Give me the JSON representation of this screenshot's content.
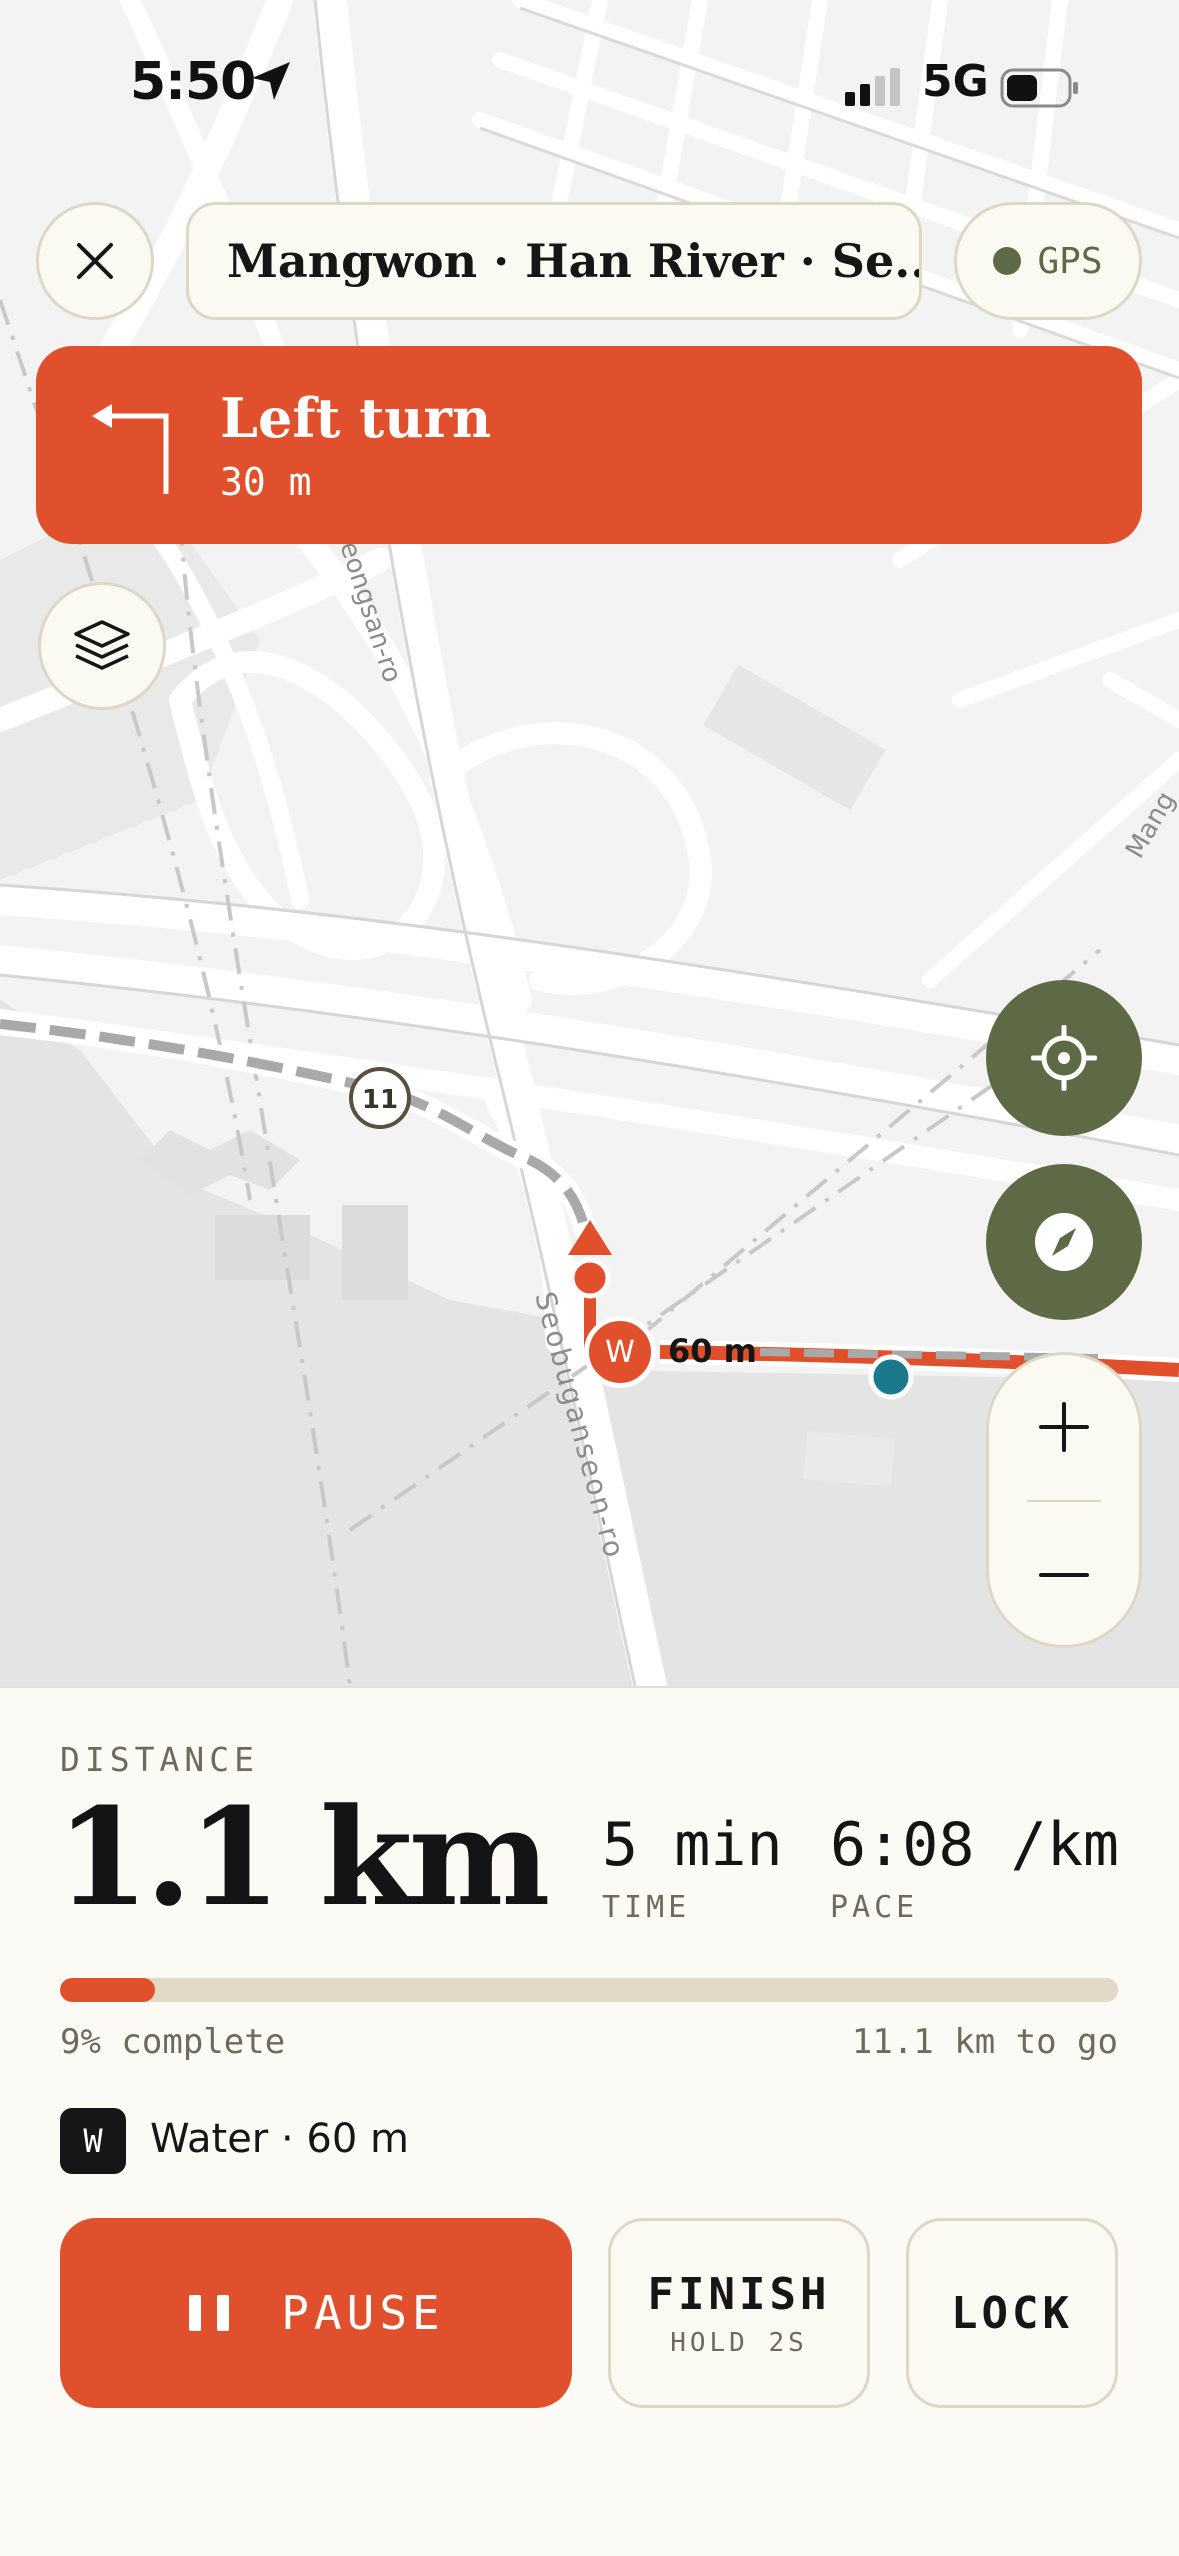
{
  "status_bar": {
    "time": "5:50",
    "network": "5G"
  },
  "top_bar": {
    "route_title": "Mangwon · Han River · Se...",
    "gps_label": "GPS"
  },
  "turn": {
    "title": "Left turn",
    "distance": "30 m"
  },
  "map": {
    "road_labels": [
      "eongsan-ro",
      "Seobuganseon-ro",
      "Mang"
    ],
    "route_shield": "11",
    "waypoint_badge": "W",
    "waypoint_distance": "60 m"
  },
  "stats": {
    "distance_label": "DISTANCE",
    "distance_value": "1.1 km",
    "time_value": "5 min",
    "time_label": "TIME",
    "pace_value": "6:08 /km",
    "pace_label": "PACE"
  },
  "progress": {
    "fraction": 0.09,
    "complete_text": "9% complete",
    "remaining_text": "11.1 km to go"
  },
  "next_point": {
    "badge": "W",
    "text": "Water · 60 m"
  },
  "actions": {
    "pause_label": "PAUSE",
    "finish_label": "FINISH",
    "finish_sub": "HOLD 2S",
    "lock_label": "LOCK"
  },
  "colors": {
    "accent": "#E0502C",
    "olive": "#5E6A45",
    "cream": "#FBFAF2",
    "track": "#E2D9C6",
    "teal": "#1A7A8C"
  },
  "icons": [
    "location-arrow-icon",
    "signal-icon",
    "battery-icon",
    "close-icon",
    "turn-left-icon",
    "layers-icon",
    "crosshair-icon",
    "compass-icon",
    "plus-icon",
    "minus-icon",
    "pause-icon"
  ]
}
